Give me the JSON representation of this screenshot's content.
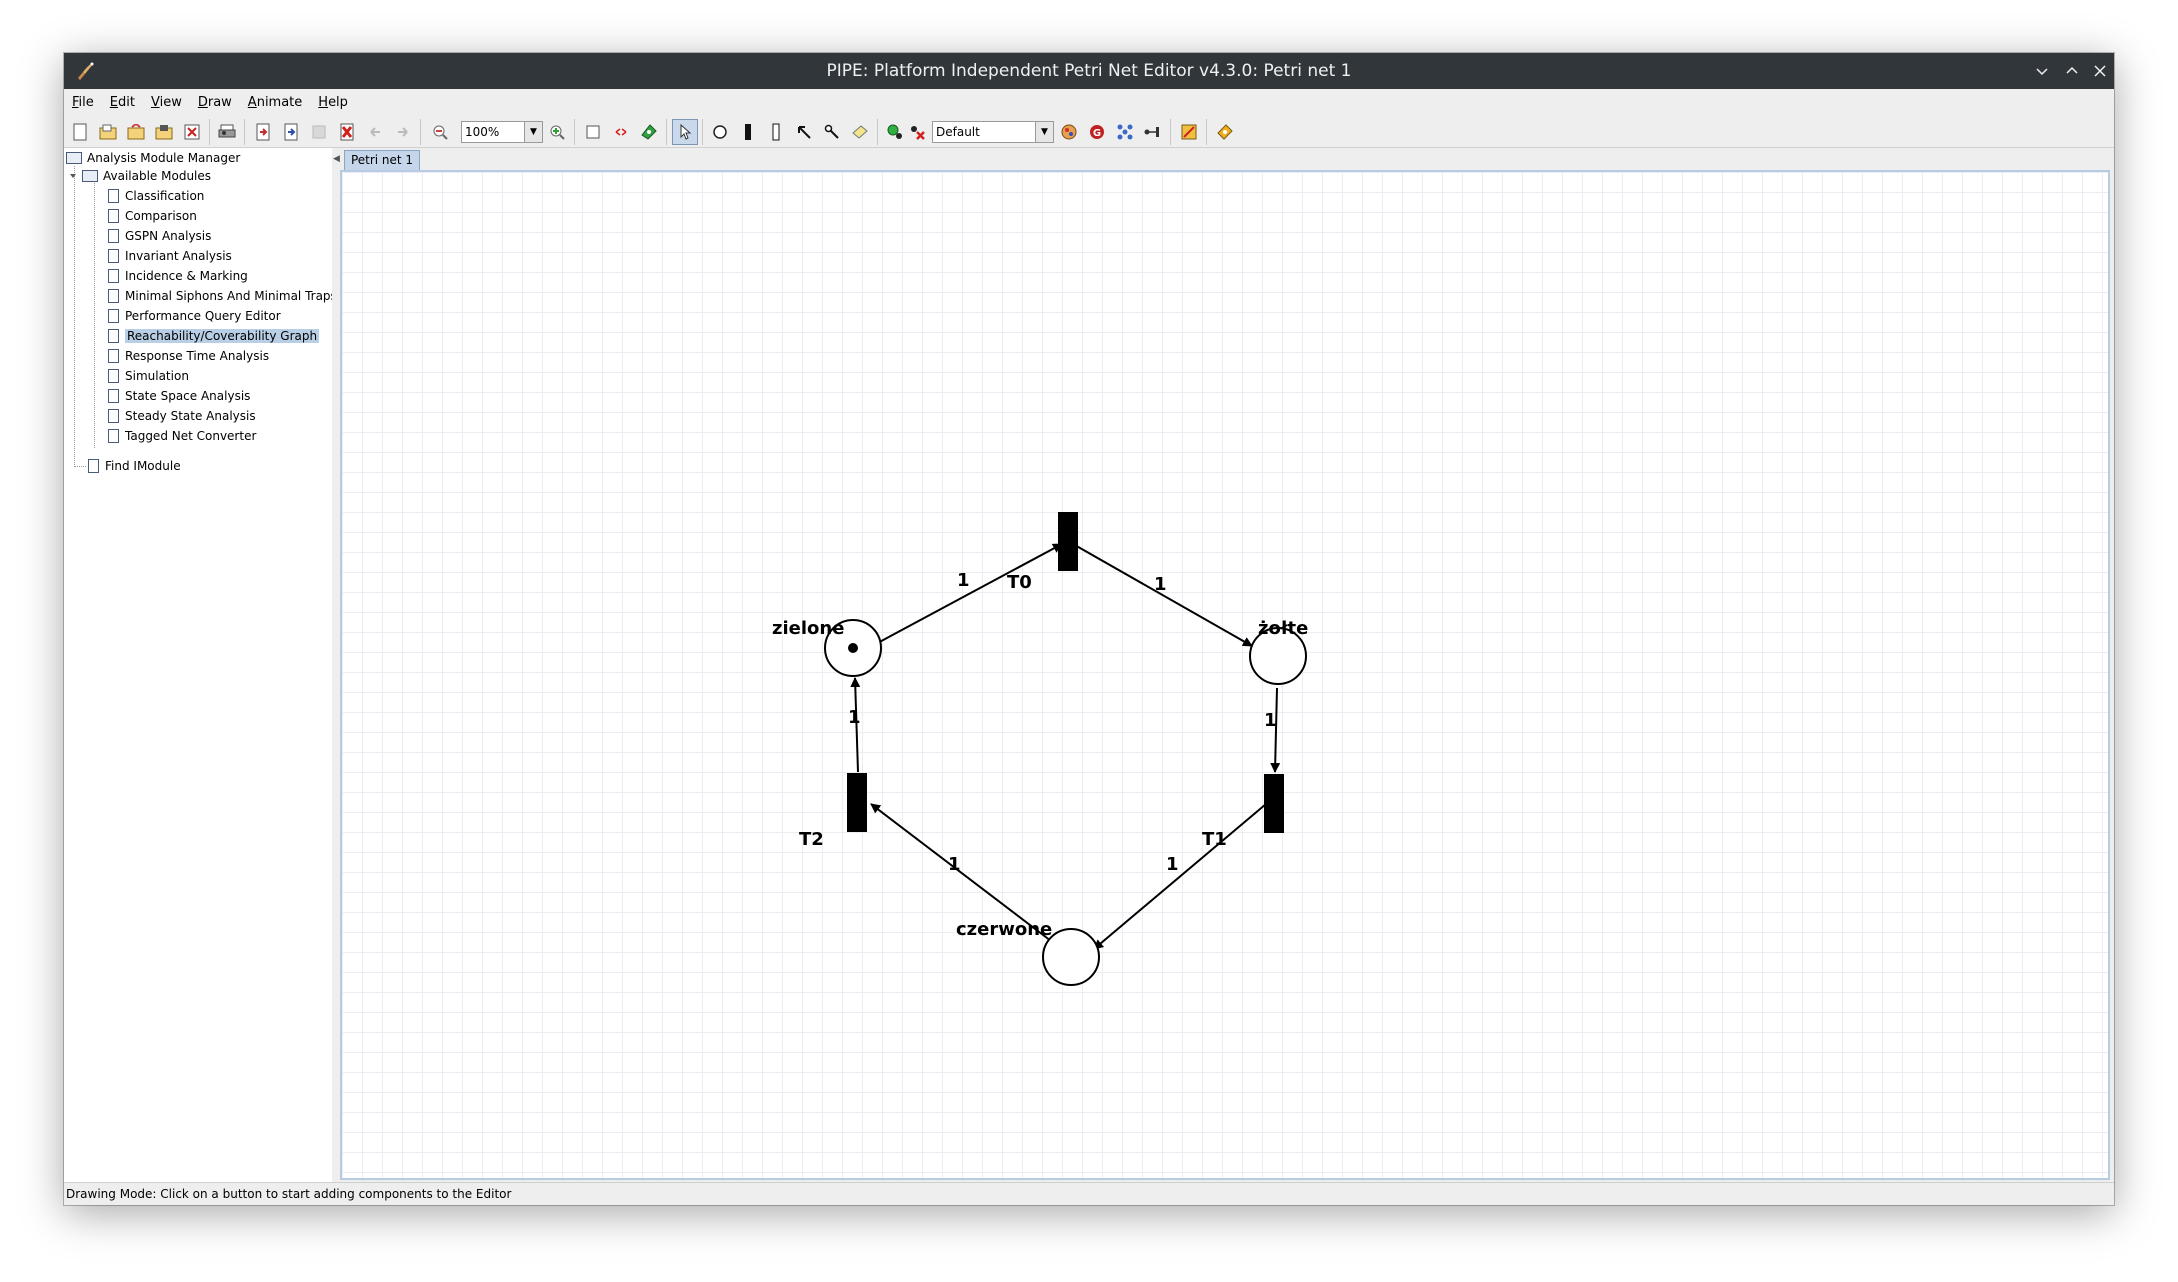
{
  "window": {
    "title": "PIPE: Platform Independent Petri Net Editor v4.3.0: Petri net 1",
    "controls": [
      "minimize",
      "maximize",
      "close"
    ]
  },
  "menu": {
    "items": [
      {
        "label": "File",
        "mnemonic": "F"
      },
      {
        "label": "Edit",
        "mnemonic": "E"
      },
      {
        "label": "View",
        "mnemonic": "V"
      },
      {
        "label": "Draw",
        "mnemonic": "D"
      },
      {
        "label": "Animate",
        "mnemonic": "A"
      },
      {
        "label": "Help",
        "mnemonic": "H"
      }
    ]
  },
  "toolbar": {
    "zoom_value": "100%",
    "token_class": "Default",
    "icons": [
      "new-file-icon",
      "open-file-icon",
      "open-folder-icon",
      "save-icon",
      "save-as-icon",
      "print-icon",
      "import-icon",
      "export-icon",
      "stop-icon",
      "close-net-icon",
      "undo-icon",
      "redo-icon",
      "zoom-out-icon",
      "zoom-in-icon",
      "grid-icon",
      "drag-icon",
      "animate-icon",
      "select-icon",
      "place-icon",
      "timed-transition-icon",
      "immediate-transition-icon",
      "arc-icon",
      "inhibitor-arc-icon",
      "annotation-icon",
      "add-token-icon",
      "delete-token-icon",
      "token-classes-icon",
      "rate-parameter-icon",
      "layout-icon",
      "fast-mode-icon",
      "tagged-arc-icon",
      "help-icon"
    ]
  },
  "sidebar": {
    "root": "Analysis Module Manager",
    "group": "Available Modules",
    "modules": [
      "Classification",
      "Comparison",
      "GSPN Analysis",
      "Invariant Analysis",
      "Incidence & Marking",
      "Minimal Siphons And Minimal Traps",
      "Performance Query Editor",
      "Reachability/Coverability Graph",
      "Response Time Analysis",
      "Simulation",
      "State Space Analysis",
      "Steady State Analysis",
      "Tagged Net Converter"
    ],
    "selected": "Reachability/Coverability Graph",
    "find": "Find IModule"
  },
  "tabs": [
    {
      "label": "Petri net 1",
      "active": true
    }
  ],
  "petri_net": {
    "places": [
      {
        "name": "zielone",
        "tokens": 1
      },
      {
        "name": "żołte",
        "tokens": 0
      },
      {
        "name": "czerwone",
        "tokens": 0
      }
    ],
    "transitions": [
      {
        "name": "T0"
      },
      {
        "name": "T1"
      },
      {
        "name": "T2"
      }
    ],
    "arcs": [
      {
        "from": "zielone",
        "to": "T0",
        "weight": "1"
      },
      {
        "from": "T0",
        "to": "żołte",
        "weight": "1"
      },
      {
        "from": "żołte",
        "to": "T1",
        "weight": "1"
      },
      {
        "from": "T1",
        "to": "czerwone",
        "weight": "1"
      },
      {
        "from": "czerwone",
        "to": "T2",
        "weight": "1"
      },
      {
        "from": "T2",
        "to": "zielone",
        "weight": "1"
      }
    ]
  },
  "status": {
    "text": "Drawing Mode: Click on a button to start adding components to the Editor"
  }
}
